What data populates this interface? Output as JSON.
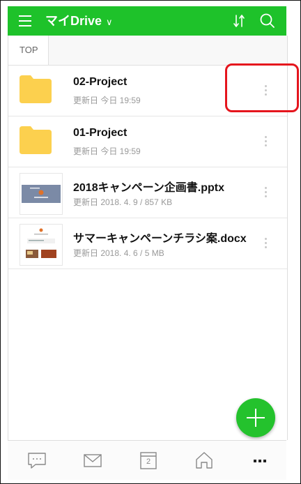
{
  "header": {
    "title": "マイDrive",
    "dropdown_glyph": "∨",
    "icons": [
      "menu-icon",
      "sort-icon",
      "search-icon"
    ],
    "background": "#1ec22a"
  },
  "breadcrumb": {
    "label": "TOP"
  },
  "files": [
    {
      "name": "02-Project",
      "meta": "更新日 今日 19:59",
      "type": "folder"
    },
    {
      "name": "01-Project",
      "meta": "更新日 今日 19:59",
      "type": "folder"
    },
    {
      "name": "2018キャンペーン企画書.pptx",
      "meta": "更新日 2018. 4. 9 / 857 KB",
      "type": "pptx"
    },
    {
      "name": "サマーキャンペーンチラシ案.docx",
      "meta": "更新日 2018. 4. 6 / 5 MB",
      "type": "docx"
    }
  ],
  "fab": {
    "icon": "plus-icon",
    "color": "#24c22d"
  },
  "bottom_nav": {
    "calendar_day": "2",
    "items": [
      "chat-icon",
      "mail-icon",
      "calendar-icon",
      "home-icon",
      "more-icon"
    ]
  },
  "annotation": {
    "color": "#e5151d"
  }
}
